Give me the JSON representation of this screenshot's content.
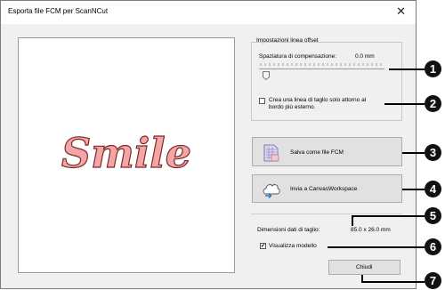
{
  "window": {
    "title": "Esporta file FCM per ScanNCut",
    "close_glyph": "✕"
  },
  "preview": {
    "artwork_text": "Smile",
    "fill_color": "#f4a5a5",
    "outline_color": "#7a2a2a"
  },
  "offset_group": {
    "legend": "Impostazioni linea offset",
    "spacing_label": "Spaziatura di compensazione:",
    "spacing_value": "0.0 mm",
    "spacing_level": 0,
    "outer_only_line1": "Crea una linea di taglio solo attorno al",
    "outer_only_line2": "bordo più esterno.",
    "outer_only_checked": false
  },
  "buttons": {
    "save_fcm": "Salva come file FCM",
    "send_canvas": "Invia a CanvasWorkspace",
    "close": "Chiudi"
  },
  "cut_data": {
    "label": "Dimensioni dati di taglio:",
    "value": "85.0 x 26.0 mm"
  },
  "show_model": {
    "label": "Visualizza modello",
    "checked": true,
    "check_glyph": "✔"
  },
  "callouts": [
    "1",
    "2",
    "3",
    "4",
    "5",
    "6",
    "7"
  ],
  "icons": {
    "save": "fcm-file-icon",
    "send": "cloud-upload-icon"
  }
}
